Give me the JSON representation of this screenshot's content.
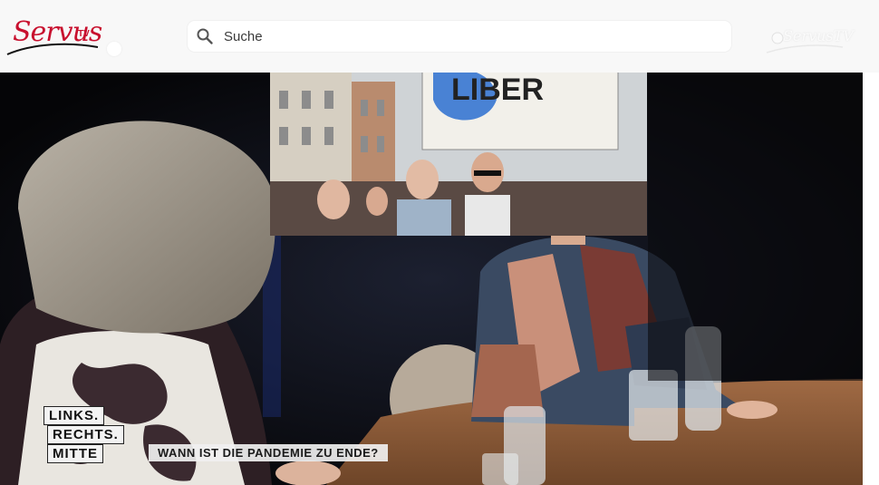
{
  "header": {
    "logo_text": "Servus",
    "logo_suffix": "TV",
    "search_placeholder": "Suche",
    "search_icon": "search-icon",
    "ghost_logo_text": "ServusTV"
  },
  "video": {
    "lower_third": {
      "line1": "LINKS.",
      "line2": "RECHTS.",
      "line3": "MITTE",
      "question": "WANN IST DIE PANDEMIE ZU ENDE?"
    },
    "screen_sign_text": "LIBER"
  },
  "colors": {
    "brand": "#c8102e",
    "header_bg": "#f8f8f8",
    "studio_bg": "#0c0c10"
  }
}
